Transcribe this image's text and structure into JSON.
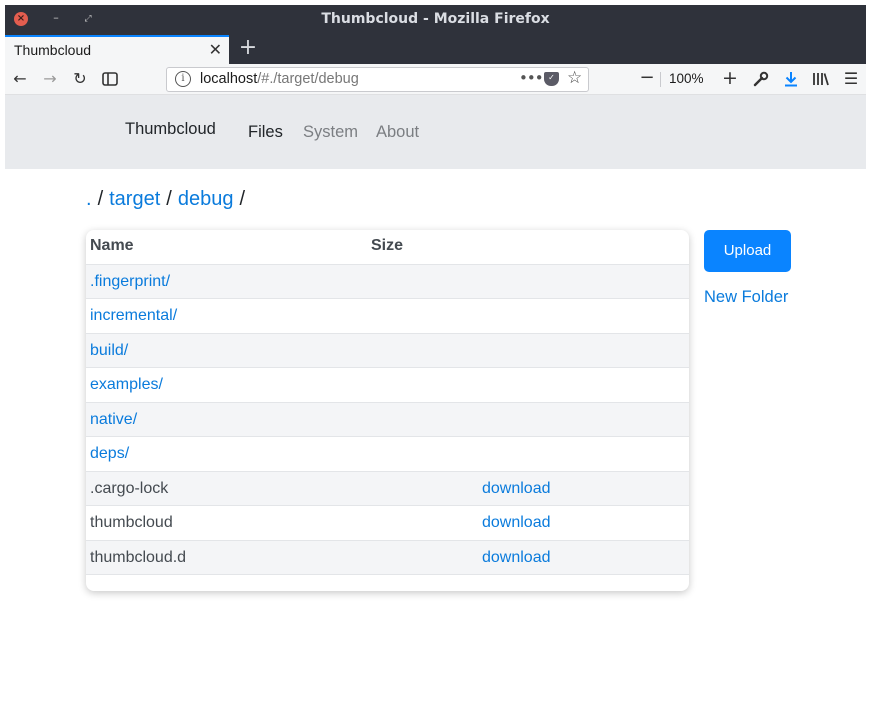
{
  "window": {
    "title": "Thumbcloud - Mozilla Firefox"
  },
  "tab": {
    "title": "Thumbcloud",
    "close_glyph": "✕",
    "new_tab_glyph": "+"
  },
  "toolbar": {
    "back_glyph": "←",
    "forward_glyph": "→",
    "reload_glyph": "↻",
    "url_host": "localhost",
    "url_path": "/#./target/debug",
    "page_actions_glyph": "•••",
    "bookmark_glyph": "☆",
    "zoom_out_glyph": "−",
    "zoom_level": "100%",
    "zoom_in_glyph": "+",
    "menu_glyph": "☰"
  },
  "site_nav": {
    "brand": "Thumbcloud",
    "links": [
      {
        "label": "Files",
        "active": true
      },
      {
        "label": "System",
        "active": false
      },
      {
        "label": "About",
        "active": false
      }
    ]
  },
  "breadcrumb": {
    "root": ".",
    "sep": "/",
    "parts": [
      "target",
      "debug"
    ]
  },
  "table": {
    "headers": {
      "name": "Name",
      "size": "Size"
    },
    "rows": [
      {
        "name": ".fingerprint/",
        "is_dir": true,
        "action": ""
      },
      {
        "name": "incremental/",
        "is_dir": true,
        "action": ""
      },
      {
        "name": "build/",
        "is_dir": true,
        "action": ""
      },
      {
        "name": "examples/",
        "is_dir": true,
        "action": ""
      },
      {
        "name": "native/",
        "is_dir": true,
        "action": ""
      },
      {
        "name": "deps/",
        "is_dir": true,
        "action": ""
      },
      {
        "name": ".cargo-lock",
        "is_dir": false,
        "action": "download"
      },
      {
        "name": "thumbcloud",
        "is_dir": false,
        "action": "download"
      },
      {
        "name": "thumbcloud.d",
        "is_dir": false,
        "action": "download"
      }
    ]
  },
  "actions": {
    "upload": "Upload",
    "new_folder": "New Folder"
  },
  "colors": {
    "accent": "#0a84ff",
    "link": "#0a7bdc",
    "nav_bg": "#e8eaed",
    "titlebar": "#2f323b"
  }
}
